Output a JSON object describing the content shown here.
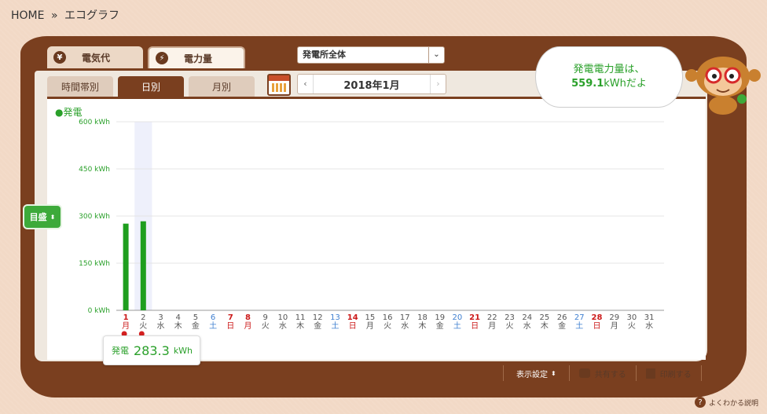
{
  "breadcrumb": {
    "home": "HOME",
    "separator": "»",
    "current": "エコグラフ"
  },
  "top_tabs": [
    {
      "icon": "yen-icon",
      "icon_glyph": "¥",
      "label": "電気代"
    },
    {
      "icon": "lightning-icon",
      "icon_glyph": "⚡",
      "label": "電力量"
    }
  ],
  "plant_select": {
    "value": "発電所全体",
    "arrow": "⌄"
  },
  "sub_tabs": [
    {
      "label": "時間帯別"
    },
    {
      "label": "日別"
    },
    {
      "label": "月別"
    }
  ],
  "date_nav": {
    "prev": "‹",
    "label": "2018年1月",
    "next": "›"
  },
  "speech": {
    "line1": "発電電力量は、",
    "value": "559.1",
    "unit_suffix": "kWhだよ"
  },
  "legend": {
    "bullet": "●",
    "label": "発電"
  },
  "mokumori_button": {
    "label": "目盛",
    "arrow": "⬍"
  },
  "tooltip": {
    "label": "発電",
    "value": "283.3",
    "unit": "kWh"
  },
  "footer": {
    "display_settings": "表示設定",
    "display_arrow": "⬍",
    "share": "共有する",
    "print": "印刷する",
    "help": "よくわかる説明",
    "help_icon": "?"
  },
  "colors": {
    "accent_brown": "#7a3f1f",
    "bar_green": "#1e9e1e",
    "sat": "#3f7fd0",
    "sun": "#cc1a1a",
    "axis_green": "#2aa02a"
  },
  "chart_data": {
    "type": "bar",
    "series": [
      {
        "name": "発電",
        "color": "#1e9e1e"
      }
    ],
    "ylim": [
      0,
      600
    ],
    "yticks": [
      "0 kWh",
      "150 kWh",
      "300 kWh",
      "450 kWh",
      "600 kWh"
    ],
    "highlighted_day": 2,
    "days": [
      {
        "d": "1",
        "w": "月",
        "type": "holiday",
        "value": 275.8
      },
      {
        "d": "2",
        "w": "火",
        "type": "weekday",
        "value": 283.3
      },
      {
        "d": "3",
        "w": "水",
        "type": "weekday",
        "value": 0
      },
      {
        "d": "4",
        "w": "木",
        "type": "weekday",
        "value": 0
      },
      {
        "d": "5",
        "w": "金",
        "type": "weekday",
        "value": 0
      },
      {
        "d": "6",
        "w": "土",
        "type": "sat",
        "value": 0
      },
      {
        "d": "7",
        "w": "日",
        "type": "sun",
        "value": 0
      },
      {
        "d": "8",
        "w": "月",
        "type": "holiday",
        "value": 0
      },
      {
        "d": "9",
        "w": "火",
        "type": "weekday",
        "value": 0
      },
      {
        "d": "10",
        "w": "水",
        "type": "weekday",
        "value": 0
      },
      {
        "d": "11",
        "w": "木",
        "type": "weekday",
        "value": 0
      },
      {
        "d": "12",
        "w": "金",
        "type": "weekday",
        "value": 0
      },
      {
        "d": "13",
        "w": "土",
        "type": "sat",
        "value": 0
      },
      {
        "d": "14",
        "w": "日",
        "type": "sun",
        "value": 0
      },
      {
        "d": "15",
        "w": "月",
        "type": "weekday",
        "value": 0
      },
      {
        "d": "16",
        "w": "火",
        "type": "weekday",
        "value": 0
      },
      {
        "d": "17",
        "w": "水",
        "type": "weekday",
        "value": 0
      },
      {
        "d": "18",
        "w": "木",
        "type": "weekday",
        "value": 0
      },
      {
        "d": "19",
        "w": "金",
        "type": "weekday",
        "value": 0
      },
      {
        "d": "20",
        "w": "土",
        "type": "sat",
        "value": 0
      },
      {
        "d": "21",
        "w": "日",
        "type": "sun",
        "value": 0
      },
      {
        "d": "22",
        "w": "月",
        "type": "weekday",
        "value": 0
      },
      {
        "d": "23",
        "w": "火",
        "type": "weekday",
        "value": 0
      },
      {
        "d": "24",
        "w": "水",
        "type": "weekday",
        "value": 0
      },
      {
        "d": "25",
        "w": "木",
        "type": "weekday",
        "value": 0
      },
      {
        "d": "26",
        "w": "金",
        "type": "weekday",
        "value": 0
      },
      {
        "d": "27",
        "w": "土",
        "type": "sat",
        "value": 0
      },
      {
        "d": "28",
        "w": "日",
        "type": "sun",
        "value": 0
      },
      {
        "d": "29",
        "w": "月",
        "type": "weekday",
        "value": 0
      },
      {
        "d": "30",
        "w": "火",
        "type": "weekday",
        "value": 0
      },
      {
        "d": "31",
        "w": "水",
        "type": "weekday",
        "value": 0
      }
    ],
    "weather_icons": [
      {
        "day": 1,
        "icon": "sun-icon"
      },
      {
        "day": 2,
        "icon": "sun-icon"
      }
    ]
  }
}
